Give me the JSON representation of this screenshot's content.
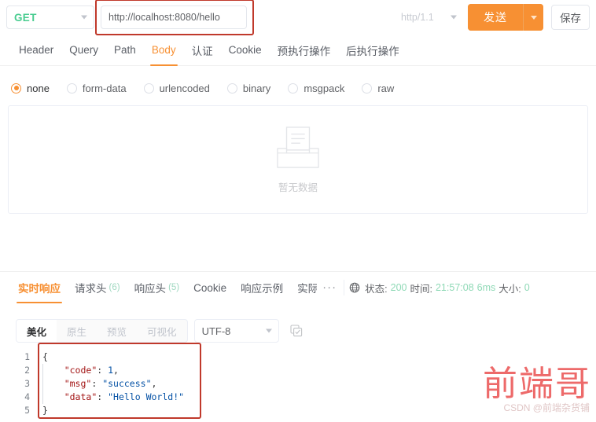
{
  "request_bar": {
    "method": "GET",
    "url_value": "http://localhost:8080/hello",
    "url_placeholder": "http://localhost:8080/hello",
    "protocol": "http/1.1",
    "send_label": "发送",
    "save_label": "保存",
    "annotation_color": "#c0392b",
    "accent_color": "#f79033",
    "method_color": "#49cc90"
  },
  "request_tabs": [
    {
      "label": "Header",
      "active": false
    },
    {
      "label": "Query",
      "active": false
    },
    {
      "label": "Path",
      "active": false
    },
    {
      "label": "Body",
      "active": true
    },
    {
      "label": "认证",
      "active": false
    },
    {
      "label": "Cookie",
      "active": false
    },
    {
      "label": "预执行操作",
      "active": false
    },
    {
      "label": "后执行操作",
      "active": false
    }
  ],
  "body_types": [
    {
      "label": "none",
      "checked": true
    },
    {
      "label": "form-data",
      "checked": false
    },
    {
      "label": "urlencoded",
      "checked": false
    },
    {
      "label": "binary",
      "checked": false
    },
    {
      "label": "msgpack",
      "checked": false
    },
    {
      "label": "raw",
      "checked": false
    }
  ],
  "empty_state": {
    "icon": "empty-tray-icon",
    "text": "暂无数据"
  },
  "response_tabs": [
    {
      "label": "实时响应",
      "count": "",
      "active": true
    },
    {
      "label": "请求头",
      "count": "(6)",
      "active": false
    },
    {
      "label": "响应头",
      "count": "(5)",
      "active": false
    },
    {
      "label": "Cookie",
      "count": "",
      "active": false
    },
    {
      "label": "响应示例",
      "count": "",
      "active": false
    },
    {
      "label": "实际请",
      "count": "",
      "active": false
    }
  ],
  "response_overflow": "···",
  "status_bar": {
    "globe_icon": "globe-icon",
    "status_key": "状态:",
    "status_value": "200",
    "time_key": "时间:",
    "time_value": "21:57:08",
    "duration_value": "6ms",
    "size_key": "大小:",
    "size_value": "0",
    "value_color": "#8fd9b6"
  },
  "view_toolbar": {
    "segments": [
      {
        "label": "美化",
        "active": true
      },
      {
        "label": "原生",
        "active": false
      },
      {
        "label": "预览",
        "active": false
      },
      {
        "label": "可视化",
        "active": false
      }
    ],
    "encoding": "UTF-8",
    "copy_icon": "copy-icon"
  },
  "code_block": {
    "line_numbers": [
      "1",
      "2",
      "3",
      "4",
      "5"
    ],
    "lines": [
      {
        "indent": "",
        "parts": [
          {
            "t": "{",
            "c": "p"
          }
        ]
      },
      {
        "indent": "    ",
        "parts": [
          {
            "t": "\"code\"",
            "c": "k"
          },
          {
            "t": ": ",
            "c": "p"
          },
          {
            "t": "1",
            "c": "n"
          },
          {
            "t": ",",
            "c": "p"
          }
        ]
      },
      {
        "indent": "    ",
        "parts": [
          {
            "t": "\"msg\"",
            "c": "k"
          },
          {
            "t": ": ",
            "c": "p"
          },
          {
            "t": "\"success\"",
            "c": "sv"
          },
          {
            "t": ",",
            "c": "p"
          }
        ]
      },
      {
        "indent": "    ",
        "parts": [
          {
            "t": "\"data\"",
            "c": "k"
          },
          {
            "t": ": ",
            "c": "p"
          },
          {
            "t": "\"Hello World!\"",
            "c": "sv"
          }
        ]
      },
      {
        "indent": "",
        "parts": [
          {
            "t": "}",
            "c": "p"
          }
        ]
      }
    ]
  },
  "watermark": {
    "main": "前端哥",
    "sub": "CSDN @前端杂货铺",
    "color": "#ea4a4a"
  }
}
